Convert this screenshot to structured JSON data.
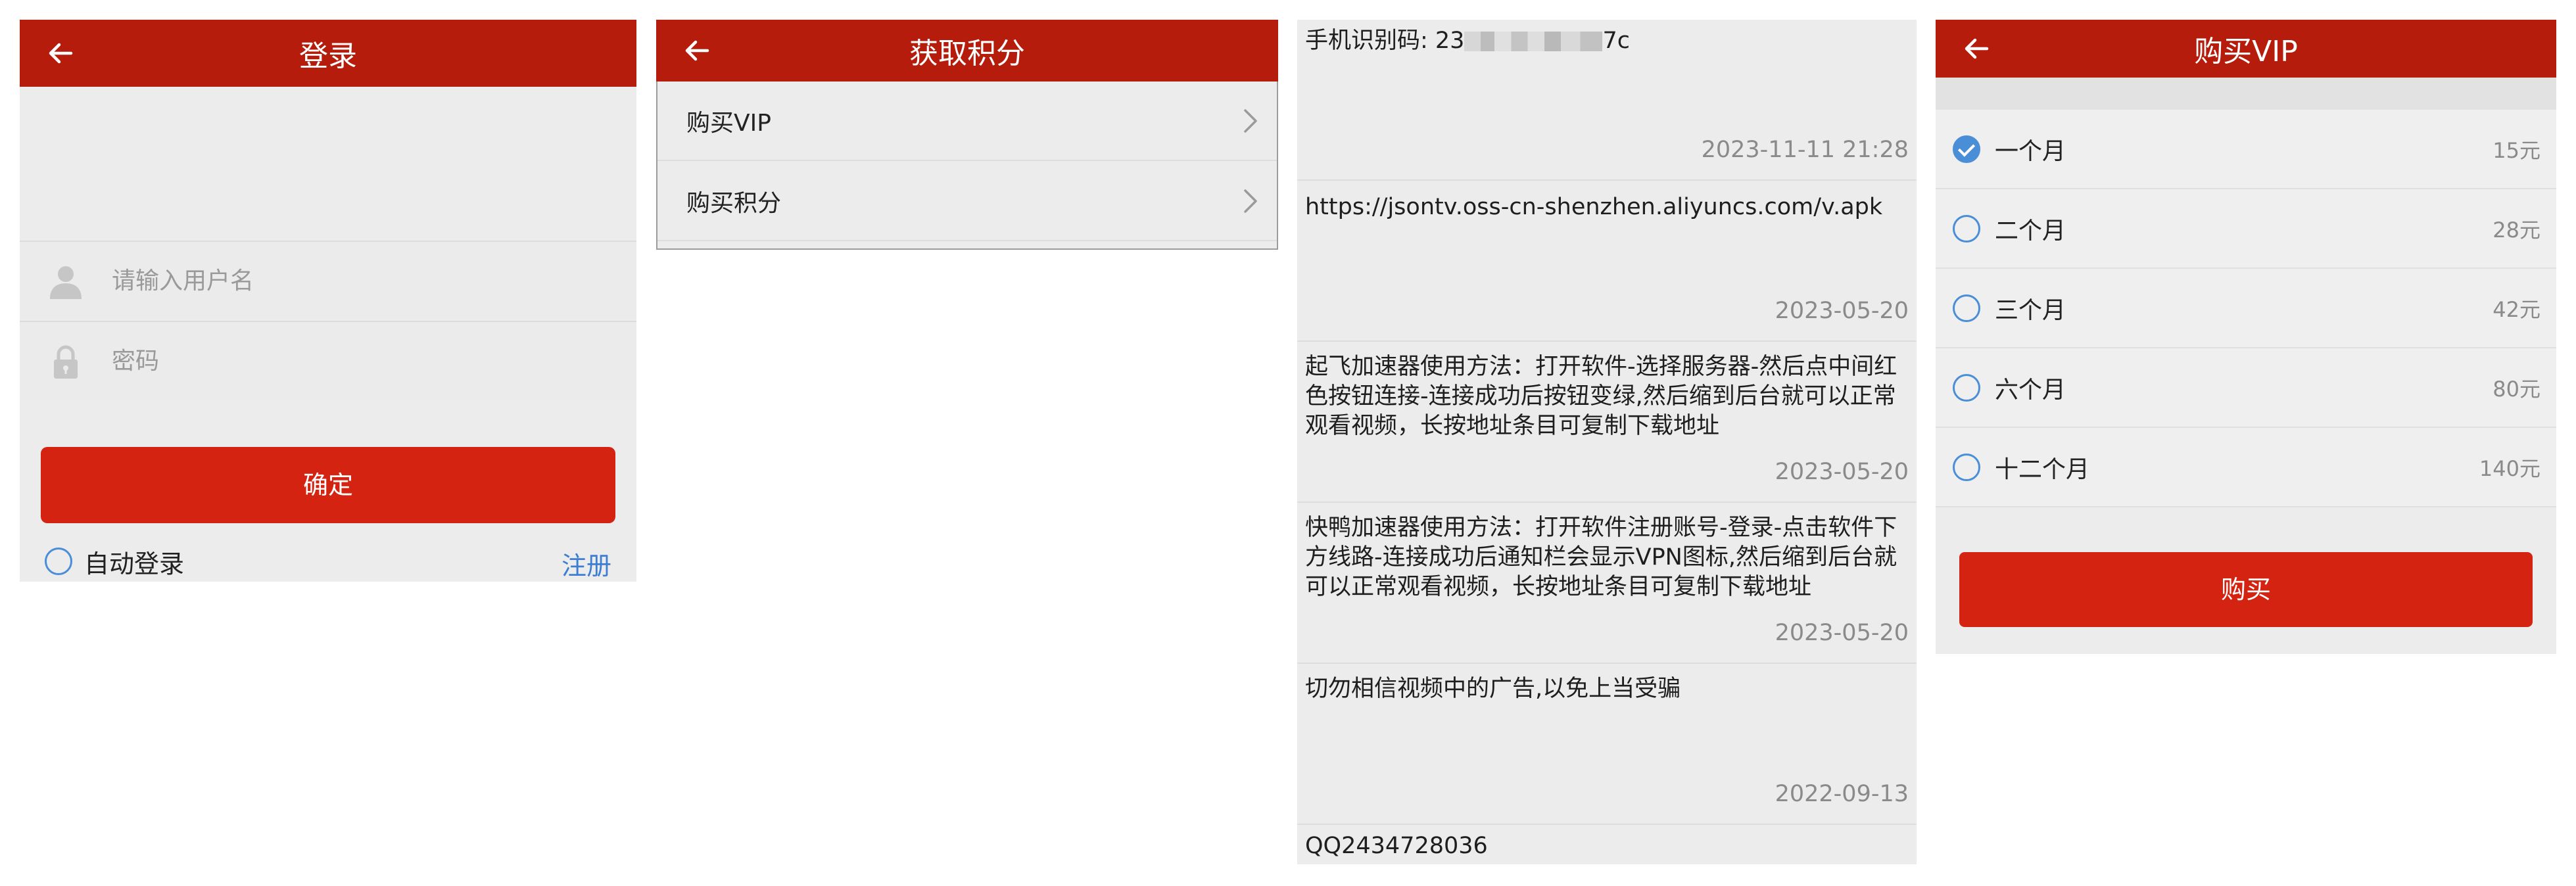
{
  "login": {
    "title": "登录",
    "username_placeholder": "请输入用户名",
    "password_placeholder": "密码",
    "confirm_label": "确定",
    "auto_login_label": "自动登录",
    "register_label": "注册"
  },
  "points": {
    "title": "获取积分",
    "items": [
      {
        "label": "购买VIP"
      },
      {
        "label": "购买积分"
      }
    ]
  },
  "messages": {
    "device_id_prefix": "手机识别码: 23",
    "device_id_suffix": "7c",
    "items": [
      {
        "text": "",
        "date": "2023-11-11 21:28"
      },
      {
        "text": "https://jsontv.oss-cn-shenzhen.aliyuncs.com/v.apk",
        "date": "2023-05-20"
      },
      {
        "text": "起飞加速器使用方法：打开软件-选择服务器-然后点中间红色按钮连接-连接成功后按钮变绿,然后缩到后台就可以正常观看视频，长按地址条目可复制下载地址",
        "date": "2023-05-20"
      },
      {
        "text": "快鸭加速器使用方法：打开软件注册账号-登录-点击软件下方线路-连接成功后通知栏会显示VPN图标,然后缩到后台就可以正常观看视频，长按地址条目可复制下载地址",
        "date": "2023-05-20"
      },
      {
        "text": "切勿相信视频中的广告,以免上当受骗",
        "date": "2022-09-13"
      },
      {
        "text": "QQ2434728036",
        "date": ""
      }
    ]
  },
  "vip": {
    "title": "购买VIP",
    "options": [
      {
        "label": "一个月",
        "price": "15元",
        "selected": true
      },
      {
        "label": "二个月",
        "price": "28元",
        "selected": false
      },
      {
        "label": "三个月",
        "price": "42元",
        "selected": false
      },
      {
        "label": "六个月",
        "price": "80元",
        "selected": false
      },
      {
        "label": "十二个月",
        "price": "140元",
        "selected": false
      }
    ],
    "buy_label": "购买"
  },
  "colors": {
    "brand_red": "#b51c0b",
    "button_red": "#d42310",
    "accent_blue": "#4a8ed8",
    "link_blue": "#3b7ed3"
  },
  "icons": [
    "back-arrow-icon",
    "user-icon",
    "lock-icon",
    "chevron-right-icon",
    "radio-icon",
    "radio-checked-icon"
  ]
}
